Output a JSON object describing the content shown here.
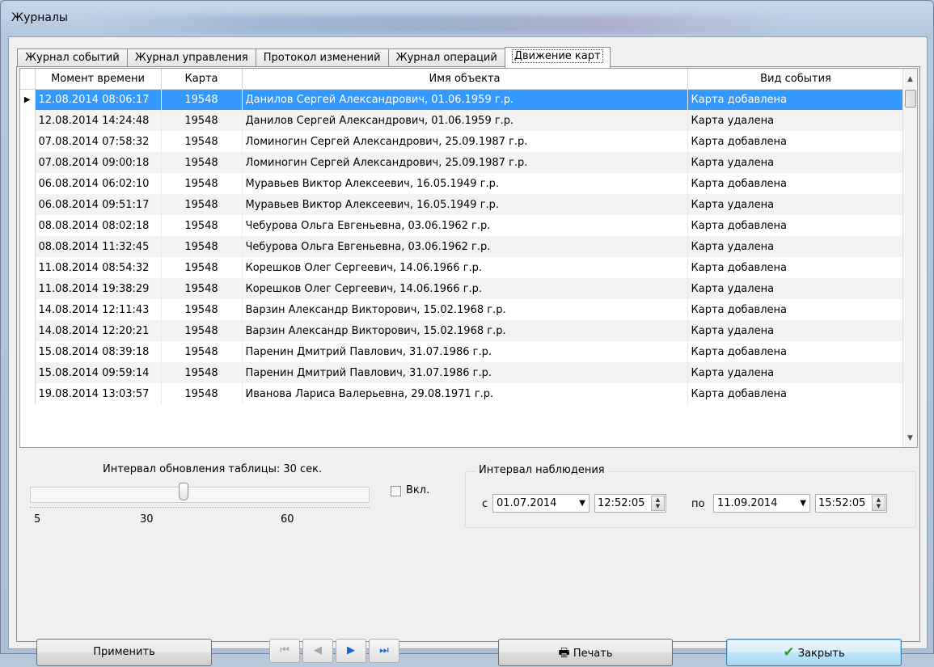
{
  "window": {
    "title": "Журналы"
  },
  "tabs": [
    {
      "label": "Журнал событий"
    },
    {
      "label": "Журнал управления"
    },
    {
      "label": "Протокол изменений"
    },
    {
      "label": "Журнал операций"
    },
    {
      "label": "Движение карт",
      "active": true
    }
  ],
  "grid": {
    "columns": [
      "Момент времени",
      "Карта",
      "Имя объекта",
      "Вид события"
    ],
    "rows": [
      {
        "time": "12.08.2014 08:06:17",
        "card": "19548",
        "name": "Данилов Сергей Александрович, 01.06.1959 г.р.",
        "event": "Карта добавлена",
        "selected": true
      },
      {
        "time": "12.08.2014 14:24:48",
        "card": "19548",
        "name": "Данилов Сергей Александрович, 01.06.1959 г.р.",
        "event": "Карта удалена"
      },
      {
        "time": "07.08.2014 07:58:32",
        "card": "19548",
        "name": "Ломиногин Сергей Александрович, 25.09.1987 г.р.",
        "event": "Карта добавлена"
      },
      {
        "time": "07.08.2014 09:00:18",
        "card": "19548",
        "name": "Ломиногин Сергей Александрович, 25.09.1987 г.р.",
        "event": "Карта удалена"
      },
      {
        "time": "06.08.2014 06:02:10",
        "card": "19548",
        "name": "Муравьев Виктор Алексеевич, 16.05.1949 г.р.",
        "event": "Карта добавлена"
      },
      {
        "time": "06.08.2014 09:51:17",
        "card": "19548",
        "name": "Муравьев Виктор Алексеевич, 16.05.1949 г.р.",
        "event": "Карта удалена"
      },
      {
        "time": "08.08.2014 08:02:18",
        "card": "19548",
        "name": "Чебурова Ольга Евгеньевна, 03.06.1962 г.р.",
        "event": "Карта добавлена"
      },
      {
        "time": "08.08.2014 11:32:45",
        "card": "19548",
        "name": "Чебурова Ольга Евгеньевна, 03.06.1962 г.р.",
        "event": "Карта удалена"
      },
      {
        "time": "11.08.2014 08:54:32",
        "card": "19548",
        "name": "Корешков Олег Сергеевич, 14.06.1966 г.р.",
        "event": "Карта добавлена"
      },
      {
        "time": "11.08.2014 19:38:29",
        "card": "19548",
        "name": "Корешков Олег Сергеевич, 14.06.1966 г.р.",
        "event": "Карта удалена"
      },
      {
        "time": "14.08.2014 12:11:43",
        "card": "19548",
        "name": "Варзин Александр Викторович, 15.02.1968 г.р.",
        "event": "Карта добавлена"
      },
      {
        "time": "14.08.2014 12:20:21",
        "card": "19548",
        "name": "Варзин Александр Викторович, 15.02.1968 г.р.",
        "event": "Карта удалена"
      },
      {
        "time": "15.08.2014 08:39:18",
        "card": "19548",
        "name": "Паренин Дмитрий Павлович, 31.07.1986 г.р.",
        "event": "Карта добавлена"
      },
      {
        "time": "15.08.2014 09:59:14",
        "card": "19548",
        "name": "Паренин Дмитрий Павлович, 31.07.1986 г.р.",
        "event": "Карта удалена"
      },
      {
        "time": "19.08.2014 13:03:57",
        "card": "19548",
        "name": "Иванова Лариса Валерьевна, 29.08.1971 г.р.",
        "event": "Карта добавлена"
      }
    ]
  },
  "refresh": {
    "label": "Интервал обновления таблицы: 30 сек.",
    "slider_value": 30,
    "scale": [
      "5",
      "30",
      "60"
    ],
    "checkbox_label": "Вкл.",
    "checked": false
  },
  "interval": {
    "legend": "Интервал наблюдения",
    "from_label": "с",
    "from_date": "01.07.2014",
    "from_time": "12:52:05",
    "to_label": "по",
    "to_date": "11.09.2014",
    "to_time": "15:52:05"
  },
  "buttons": {
    "apply": "Применить",
    "print": "Печать",
    "close": "Закрыть",
    "first": "⏮",
    "prev": "◀",
    "next": "▶",
    "last": "⏭"
  },
  "icons": {
    "selected_row": "row-pointer-icon",
    "print": "printer-icon",
    "close": "checkmark-icon"
  }
}
